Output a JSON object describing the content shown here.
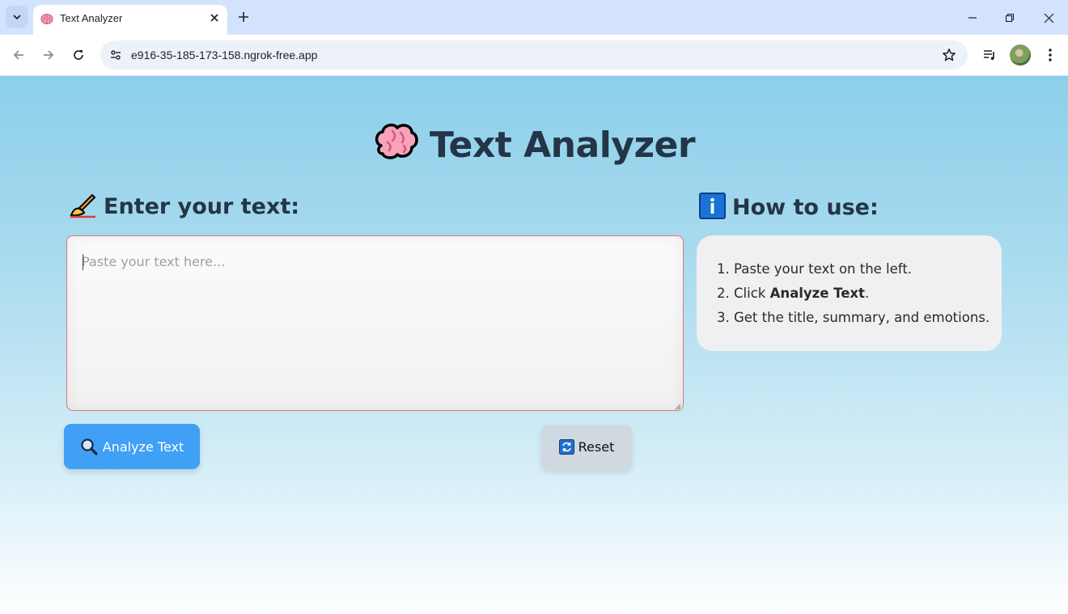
{
  "browser": {
    "tab_title": "Text Analyzer",
    "url": "e916-35-185-173-158.ngrok-free.app",
    "icons": {
      "tab_menu": "chevron-down-icon",
      "favicon": "brain-icon",
      "tab_close": "close-icon",
      "new_tab": "plus-icon",
      "minimize": "minimize-icon",
      "restore": "restore-icon",
      "close_window": "close-icon",
      "back": "back-arrow-icon",
      "forward": "forward-arrow-icon",
      "reload": "reload-icon",
      "site_info": "site-settings-icon",
      "bookmark": "star-icon",
      "media": "media-playlist-icon",
      "profile": "avatar",
      "menu": "kebab-menu-icon"
    }
  },
  "app": {
    "title": "Text Analyzer",
    "title_icon": "brain-emoji",
    "input_section": {
      "heading": "Enter your text:",
      "icon": "writing-hand-emoji",
      "placeholder": "Paste your text here...",
      "value": ""
    },
    "help_section": {
      "heading": "How to use:",
      "icon": "information-emoji",
      "steps": {
        "s1": {
          "num": "1.",
          "text": "Paste your text on the left."
        },
        "s2": {
          "num": "2.",
          "pre": "Click ",
          "bold": "Analyze Text",
          "post": "."
        },
        "s3": {
          "num": "3.",
          "text": "Get the title, summary, and emotions."
        }
      }
    },
    "buttons": {
      "analyze": {
        "label": "Analyze Text",
        "icon": "magnifier-emoji",
        "color": "#3fa0f5"
      },
      "reset": {
        "label": "Reset",
        "icon": "refresh-emoji",
        "color": "#cfd9df"
      }
    }
  },
  "colors": {
    "tabstrip": "#d3e3fd",
    "page_gradient_top": "#8ccfea",
    "page_gradient_bottom": "#ffffff",
    "heading_text": "#233547",
    "textarea_border": "#e0757a",
    "info_card": "#f0f0f3"
  }
}
